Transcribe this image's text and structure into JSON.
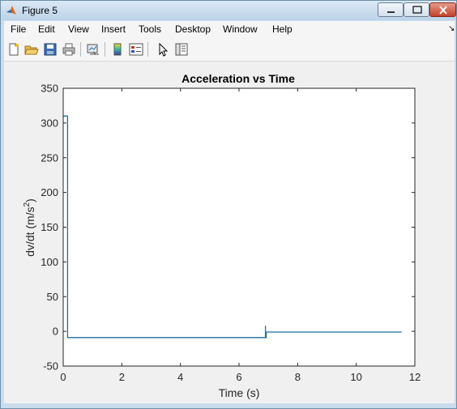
{
  "window": {
    "title": "Figure 5",
    "app_icon": "matlab-icon"
  },
  "menu": {
    "items": [
      "File",
      "Edit",
      "View",
      "Insert",
      "Tools",
      "Desktop",
      "Window",
      "Help"
    ]
  },
  "toolbar": {
    "icons": [
      "new-figure-icon",
      "open-file-icon",
      "save-icon",
      "print-icon",
      "link-plot-icon",
      "insert-colorbar-icon",
      "insert-legend-icon",
      "edit-plot-pointer-icon",
      "property-editor-icon"
    ]
  },
  "chart_data": {
    "type": "line",
    "title": "Acceleration vs Time",
    "xlabel": "Time (s)",
    "ylabel_base": "dv/dt (m/s",
    "ylabel_exp": "2",
    "ylabel_close": ")",
    "xlim": [
      0,
      12
    ],
    "ylim": [
      -50,
      350
    ],
    "xticks": [
      0,
      2,
      4,
      6,
      8,
      10,
      12
    ],
    "yticks": [
      -50,
      0,
      50,
      100,
      150,
      200,
      250,
      300,
      350
    ],
    "grid": false,
    "color": "#1f6fa0",
    "series": [
      {
        "x": [
          0,
          0.15,
          0.15,
          0.15,
          6.9,
          6.9,
          6.9,
          6.93,
          6.93,
          11.55
        ],
        "y": [
          310,
          310,
          305,
          -9,
          -9,
          8,
          -9,
          -9,
          -1,
          -1
        ]
      }
    ]
  }
}
